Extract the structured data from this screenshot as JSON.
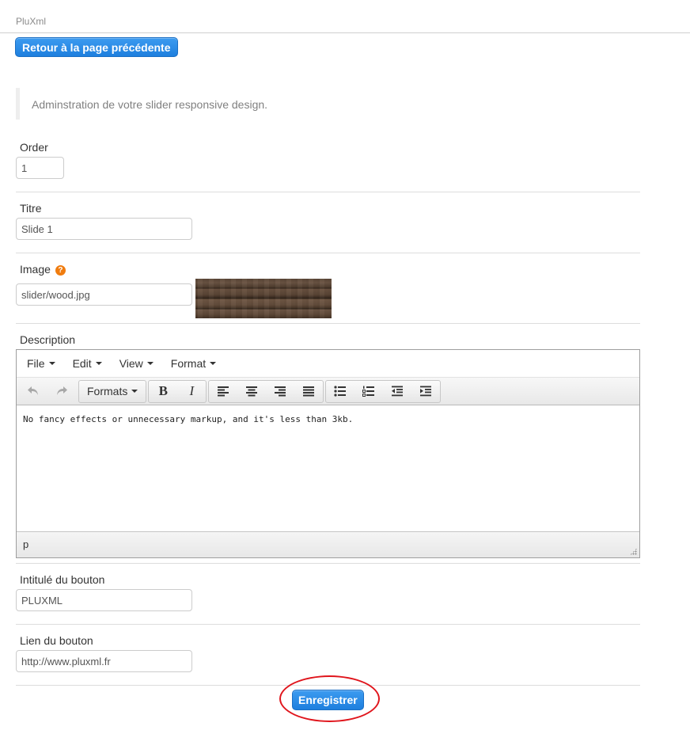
{
  "app": {
    "breadcrumb": "PluXml"
  },
  "actions": {
    "back_label": "Retour à la page précédente",
    "save_label": "Enregistrer"
  },
  "intro": {
    "text": "Adminstration de votre slider responsive design."
  },
  "form": {
    "order": {
      "label": "Order",
      "value": "1"
    },
    "title": {
      "label": "Titre",
      "value": "Slide 1"
    },
    "image": {
      "label": "Image",
      "value": "slider/wood.jpg",
      "help_icon": "question-circle-icon",
      "help_glyph": "?"
    },
    "description": {
      "label": "Description"
    },
    "button_label": {
      "label": "Intitulé du bouton",
      "value": "PLUXML"
    },
    "button_link": {
      "label": "Lien du bouton",
      "value": "http://www.pluxml.fr"
    }
  },
  "editor": {
    "menus": [
      "File",
      "Edit",
      "View",
      "Format"
    ],
    "toolbar": {
      "formats_label": "Formats",
      "bold_glyph": "B",
      "italic_glyph": "I",
      "icons": [
        "undo-icon",
        "redo-icon",
        "bold-icon",
        "italic-icon",
        "align-left-icon",
        "align-center-icon",
        "align-right-icon",
        "align-justify-icon",
        "bullet-list-icon",
        "numbered-list-icon",
        "outdent-icon",
        "indent-icon"
      ]
    },
    "content": "No fancy effects or unnecessary markup, and it's less than 3kb.",
    "status_path": "p"
  },
  "colors": {
    "primary_button": "#2185e4",
    "highlight_ring": "#e0151c",
    "help_icon": "#f07c0f"
  }
}
